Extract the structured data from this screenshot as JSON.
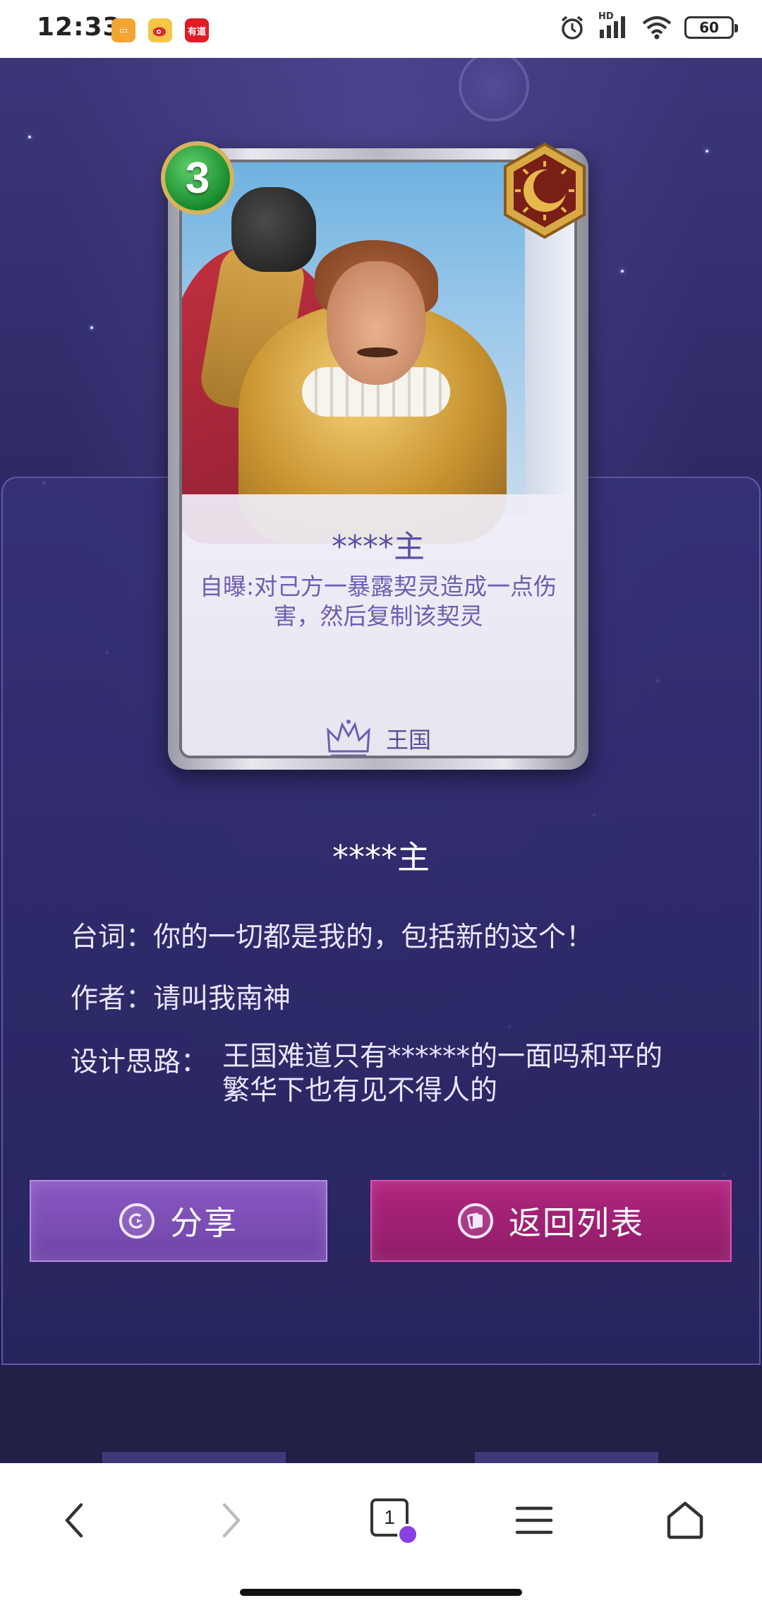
{
  "status_bar": {
    "time": "12:33",
    "notification_icons": [
      "slides-app-icon",
      "weibo-app-icon",
      "youdao-app-icon"
    ],
    "youdao_label": "有道",
    "network_label": "HD",
    "battery": "60"
  },
  "card": {
    "cost": "3",
    "name": "****主",
    "description": "自曝:对己方一暴露契灵造成一点伤害，然后复制该契灵",
    "faction": "王国",
    "class_icon": "sun-moon-badge-icon"
  },
  "details": {
    "title": "****主",
    "quote_label": "台词：",
    "quote": "你的一切都是我的，包括新的这个！",
    "author_label": "作者：",
    "author": "请叫我南神",
    "design_label": "设计思路：",
    "design": "王国难道只有******的一面吗和平的繁华下也有见不得人的"
  },
  "buttons": {
    "share": "分享",
    "back_to_list": "返回列表"
  },
  "browser_bar": {
    "tab_count": "1"
  },
  "colors": {
    "page_bg": "#2e2a66",
    "share_button": "#7b4fb6",
    "back_button": "#a1237a",
    "card_text": "#5a4fa8"
  }
}
